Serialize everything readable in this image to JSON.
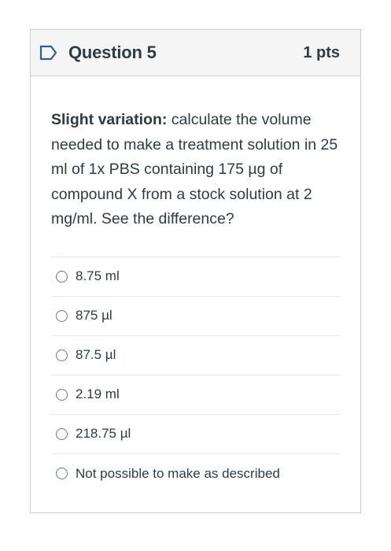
{
  "question": {
    "title": "Question 5",
    "points": "1 pts",
    "prompt_bold": "Slight variation:",
    "prompt_rest": " calculate the volume needed to make a treatment solution in 25 ml of 1x PBS containing 175 µg of compound X from a stock solution at 2 mg/ml. See the difference?"
  },
  "answers": [
    {
      "label": "8.75 ml",
      "selected": false
    },
    {
      "label": "875 µl",
      "selected": false
    },
    {
      "label": "87.5 µl",
      "selected": false
    },
    {
      "label": "2.19 ml",
      "selected": false
    },
    {
      "label": "218.75 µl",
      "selected": false
    },
    {
      "label": "Not possible to make as described",
      "selected": false
    }
  ],
  "colors": {
    "text": "#2d3b45",
    "flag": "#2b5ea7",
    "header_bg": "#f5f5f5",
    "border": "#c7cdd1"
  },
  "icons": {
    "flag": "bookmark-flag-icon",
    "radio": "radio-circle"
  }
}
